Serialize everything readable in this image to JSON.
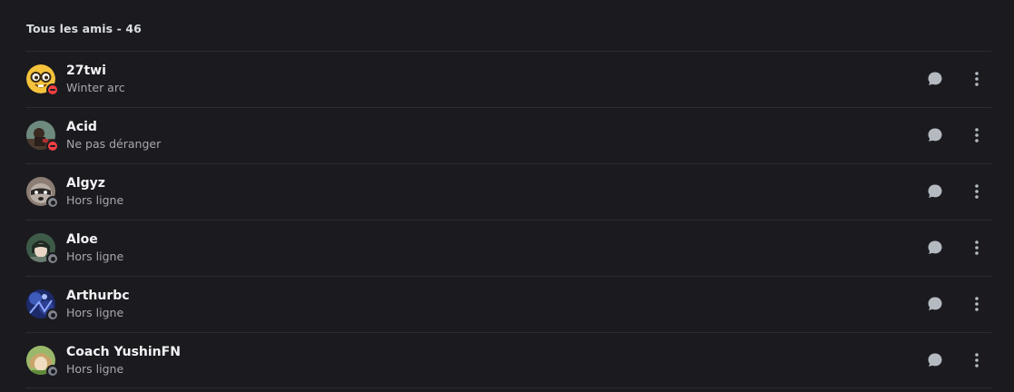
{
  "section": {
    "title": "Tous les amis - 46"
  },
  "colors": {
    "background": "#1b1b1f",
    "divider": "#2b2c31",
    "dnd": "#f23f43",
    "offline": "#80848e",
    "icon": "#b5bac1"
  },
  "friends": [
    {
      "name": "27twi",
      "status_text": "Winter arc",
      "presence": "dnd",
      "avatar_icon": "nerd-emoji-avatar"
    },
    {
      "name": "Acid",
      "status_text": "Ne pas déranger",
      "presence": "dnd",
      "avatar_icon": "character-avatar"
    },
    {
      "name": "Algyz",
      "status_text": "Hors ligne",
      "presence": "offline",
      "avatar_icon": "raccoon-avatar"
    },
    {
      "name": "Aloe",
      "status_text": "Hors ligne",
      "presence": "offline",
      "avatar_icon": "anime-avatar"
    },
    {
      "name": "Arthurbc",
      "status_text": "Hors ligne",
      "presence": "offline",
      "avatar_icon": "blue-art-avatar"
    },
    {
      "name": "Coach YushinFN",
      "status_text": "Hors ligne",
      "presence": "offline",
      "avatar_icon": "green-anime-avatar"
    }
  ]
}
